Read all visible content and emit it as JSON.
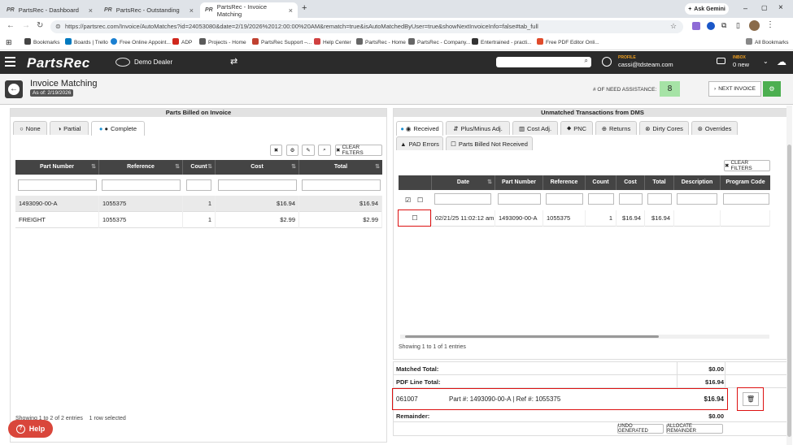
{
  "browser": {
    "tabs": [
      {
        "label": "PartsRec - Dashboard",
        "active": false
      },
      {
        "label": "PartsRec - Outstanding",
        "active": false
      },
      {
        "label": "PartsRec - Invoice Matching",
        "active": true
      }
    ],
    "url": "https://partsrec.com/Invoice/AutoMatches?id=24053080&date=2/19/2026%2012:00:00%20AM&rematch=true&isAutoMatchedByUser=true&showNextInvoiceInfo=false#tab_full",
    "ask_gemini": "Ask Gemini",
    "bookmarks": [
      "Bookmarks",
      "Boards | Trello",
      "Free Online Appoint...",
      "ADP",
      "Projects - Home",
      "PartsRec Support –...",
      "Help Center",
      "PartsRec - Home",
      "PartsRec - Company...",
      "Entertrained - practi...",
      "Free PDF Editor Onli..."
    ],
    "all_bookmarks": "All Bookmarks"
  },
  "app": {
    "logo": "PartsRec",
    "dealer": "Demo Dealer",
    "profile_label": "PROFILE",
    "profile_email": "cassi@tdsteam.com",
    "inbox_label": "INBOX",
    "inbox_count": "0 new",
    "search_placeholder": ""
  },
  "page": {
    "title": "Invoice Matching",
    "as_of": "As of: 2/19/2026",
    "need_assist_label": "# OF NEED ASSISTANCE:",
    "need_assist_count": "8",
    "next_invoice": "NEXT INVOICE"
  },
  "left": {
    "title": "Parts Billed on Invoice",
    "tabs": [
      "None",
      "Partial",
      "Complete"
    ],
    "clear_filters": "CLEAR FILTERS",
    "columns": [
      "Part Number",
      "Reference",
      "Count",
      "Cost",
      "Total"
    ],
    "rows": [
      [
        "1493090-00-A",
        "1055375",
        "1",
        "$16.94",
        "$16.94"
      ],
      [
        "FREIGHT",
        "1055375",
        "1",
        "$2.99",
        "$2.99"
      ]
    ],
    "footer": "Showing 1 to 2 of 2 entries",
    "selected": "1 row selected"
  },
  "right": {
    "title": "Unmatched Transactions from DMS",
    "tabs": [
      "Received",
      "Plus/Minus Adj.",
      "Cost Adj.",
      "PNC",
      "Returns",
      "Dirty Cores",
      "Overrides",
      "PAD Errors",
      "Parts Billed Not Received"
    ],
    "clear_filters": "CLEAR FILTERS",
    "columns": [
      "Date",
      "Part Number",
      "Reference",
      "Count",
      "Cost",
      "Total",
      "Description",
      "Program Code"
    ],
    "rows": [
      [
        "02/21/25 11:02:12 am",
        "1493090-00-A",
        "1055375",
        "1",
        "$16.94",
        "$16.94",
        "",
        ""
      ]
    ],
    "footer": "Showing 1 to 1 of 1 entries",
    "matched_total_label": "Matched Total:",
    "matched_total": "$0.00",
    "pdf_line_label": "PDF Line Total:",
    "pdf_line_total": "$16.94",
    "match_id": "061007",
    "match_desc": "Part #: 1493090-00-A | Ref #: 1055375",
    "match_amount": "$16.94",
    "remainder_label": "Remainder:",
    "remainder": "$0.00",
    "undo": "UNDO GENERATED",
    "allocate": "ALLOCATE REMAINDER"
  },
  "help": "Help"
}
